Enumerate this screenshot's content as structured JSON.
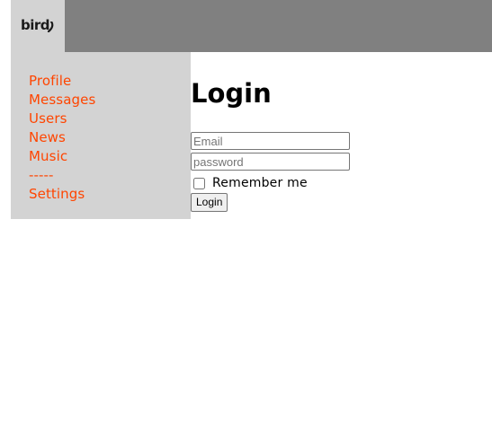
{
  "header": {
    "logo_text": "bird"
  },
  "sidebar": {
    "items": [
      {
        "label": "Profile"
      },
      {
        "label": "Messages"
      },
      {
        "label": "Users"
      },
      {
        "label": "News"
      },
      {
        "label": "Music"
      },
      {
        "label": "-----"
      },
      {
        "label": "Settings"
      }
    ]
  },
  "main": {
    "title": "Login",
    "form": {
      "email_placeholder": "Email",
      "email_value": "",
      "password_placeholder": "password",
      "password_value": "",
      "remember_label": "Remember me",
      "remember_checked": false,
      "submit_label": "Login"
    }
  },
  "colors": {
    "header_bg": "#808080",
    "sidebar_bg": "#d3d3d3",
    "nav_link": "#ff4500"
  }
}
